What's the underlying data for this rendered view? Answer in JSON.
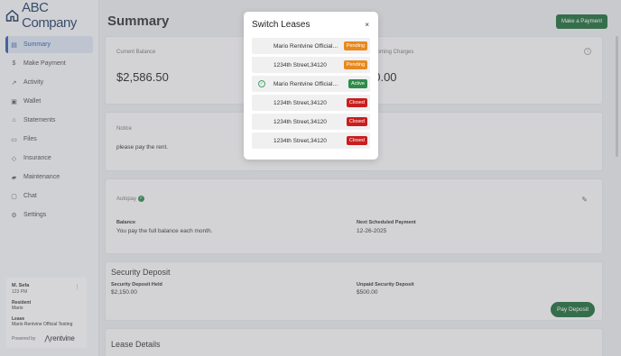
{
  "brand": {
    "name": "ABC Company",
    "color": "#1f3e66"
  },
  "nav": {
    "items": [
      {
        "label": "Summary",
        "icon": "document-icon",
        "active": true
      },
      {
        "label": "Make Payment",
        "icon": "dollar-icon"
      },
      {
        "label": "Activity",
        "icon": "trend-icon"
      },
      {
        "label": "Wallet",
        "icon": "wallet-icon"
      },
      {
        "label": "Statements",
        "icon": "bank-icon"
      },
      {
        "label": "Files",
        "icon": "folder-icon"
      },
      {
        "label": "Insurance",
        "icon": "shield-icon"
      },
      {
        "label": "Maintenance",
        "icon": "truck-icon"
      },
      {
        "label": "Chat",
        "icon": "chat-icon"
      },
      {
        "label": "Settings",
        "icon": "settings-icon"
      }
    ]
  },
  "user": {
    "name": "M. Sefa",
    "code": "123 PM",
    "resident_label": "Resident",
    "resident_value": "Mario",
    "lease_label": "Lease",
    "lease_value": "Mario Rentvine Official Testing",
    "powered_label": "Powered by",
    "powered_brand": "rentvine"
  },
  "main": {
    "title": "Summary",
    "make_payment_label": "Make a Payment",
    "current_balance_label": "Current Balance",
    "current_balance_value": "$2,586.50",
    "upcoming_label": "Upcoming Charges",
    "upcoming_value": "$0.00",
    "notice_label": "Notice",
    "notice_text": "please pay the rent.",
    "autopay_label": "Autopay",
    "balance_label": "Balance",
    "balance_text": "You pay the full balance each month.",
    "next_payment_label": "Next Scheduled Payment",
    "next_payment_value": "12-26-2025",
    "deposit_title": "Security Deposit",
    "deposit_held_label": "Security Deposit Held",
    "deposit_held_value": "$2,150.00",
    "unpaid_deposit_label": "Unpaid Security Deposit",
    "unpaid_deposit_value": "$500.00",
    "pay_deposit_label": "Pay Deposit",
    "lease_details_title": "Lease Details"
  },
  "modal": {
    "title": "Switch Leases",
    "close_symbol": "×",
    "leases": [
      {
        "address": "Mario Rentvine Official Testing",
        "status": "Pending",
        "status_color": "#e8891e",
        "selected": false
      },
      {
        "address": "1234th Street,34120",
        "status": "Pending",
        "status_color": "#e8891e",
        "selected": false
      },
      {
        "address": "Mario Rentvine Official Testing",
        "status": "Active",
        "status_color": "#2e8b4a",
        "selected": true
      },
      {
        "address": "1234th Street,34120",
        "status": "Closed",
        "status_color": "#c81e1e",
        "selected": false
      },
      {
        "address": "1234th Street,34120",
        "status": "Closed",
        "status_color": "#c81e1e",
        "selected": false
      },
      {
        "address": "1234th Street,34120",
        "status": "Closed",
        "status_color": "#c81e1e",
        "selected": false
      }
    ]
  }
}
